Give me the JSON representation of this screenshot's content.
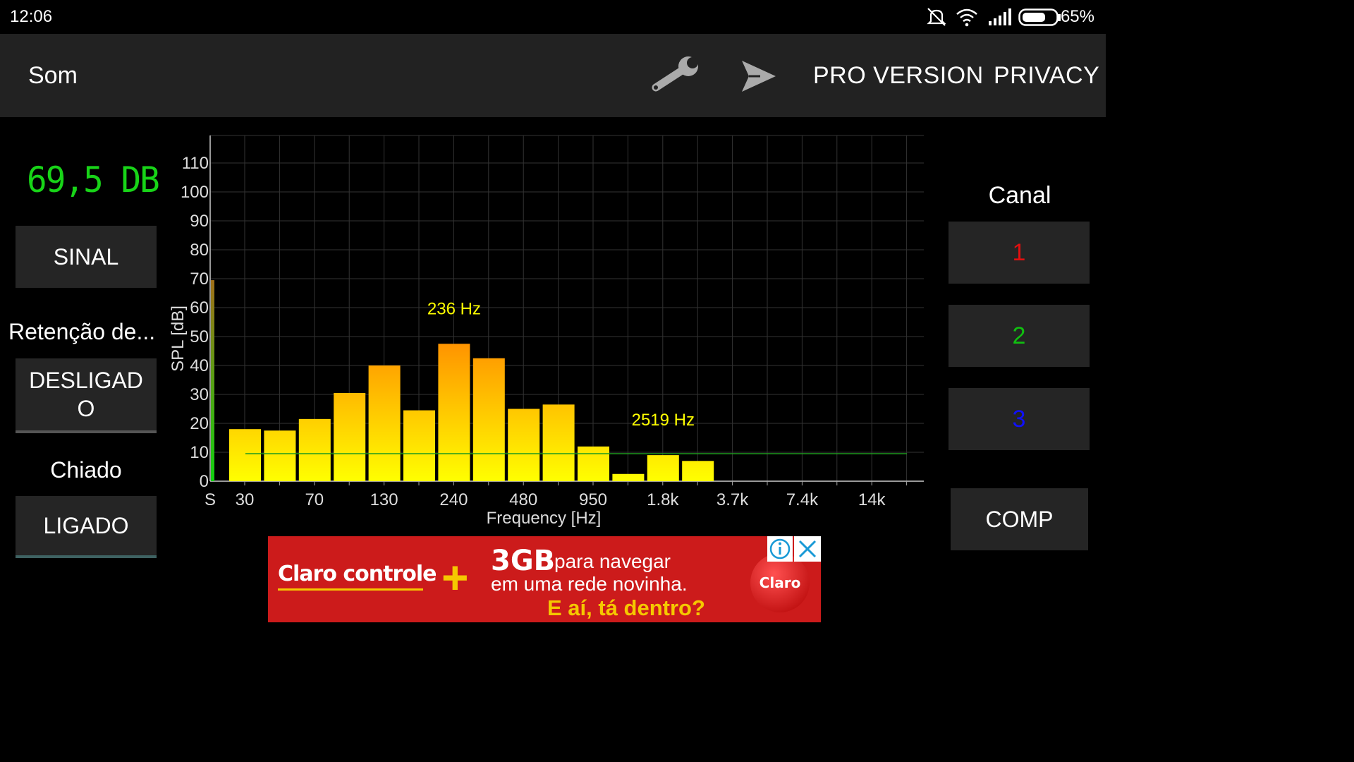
{
  "status_bar": {
    "time": "12:06",
    "battery": "65%"
  },
  "app_bar": {
    "title": "Som",
    "settings_icon": "wrench-icon",
    "send_icon": "send-icon",
    "pro_version": "PRO VERSION",
    "privacy": "PRIVACY"
  },
  "left_panel": {
    "db_value": "69,5 DB",
    "sinal_button": "SINAL",
    "retention_label": "Retenção de...",
    "retention_button": "DESLIGADO",
    "noise_label": "Chiado",
    "noise_button": "LIGADO"
  },
  "right_panel": {
    "channel_label": "Canal",
    "channels": [
      "1",
      "2",
      "3"
    ],
    "channel_colors": [
      "#e01010",
      "#10c010",
      "#1010ff"
    ],
    "comp_button": "COMP"
  },
  "chart_data": {
    "type": "bar",
    "xlabel": "Frequency [Hz]",
    "ylabel": "SPL [dB]",
    "ylim": [
      0,
      110
    ],
    "y_ticks": [
      "0",
      "10",
      "20",
      "30",
      "40",
      "50",
      "60",
      "70",
      "80",
      "90",
      "100",
      "110"
    ],
    "x_tick_labels": [
      "S",
      "30",
      "70",
      "130",
      "240",
      "480",
      "950",
      "1.8k",
      "3.7k",
      "7.4k",
      "14k"
    ],
    "sum_bar_value": 69.5,
    "threshold_line": 9.5,
    "values": [
      18,
      17.5,
      21.5,
      30.5,
      40,
      24.5,
      47.5,
      42.5,
      25,
      26.5,
      12,
      2.5,
      9,
      7
    ],
    "peak_labels": [
      {
        "text": "236 Hz",
        "bar_index": 6
      },
      {
        "text": "2519 Hz",
        "bar_index": 12
      }
    ]
  },
  "ad": {
    "brand": "Claro controle",
    "plus": "+",
    "headline": "3GB",
    "line1": "para navegar",
    "line2": "em uma rede novinha.",
    "line3": "E aí, tá dentro?",
    "logo_text": "Claro",
    "info_icon": "info-icon",
    "close_icon": "close-icon"
  }
}
